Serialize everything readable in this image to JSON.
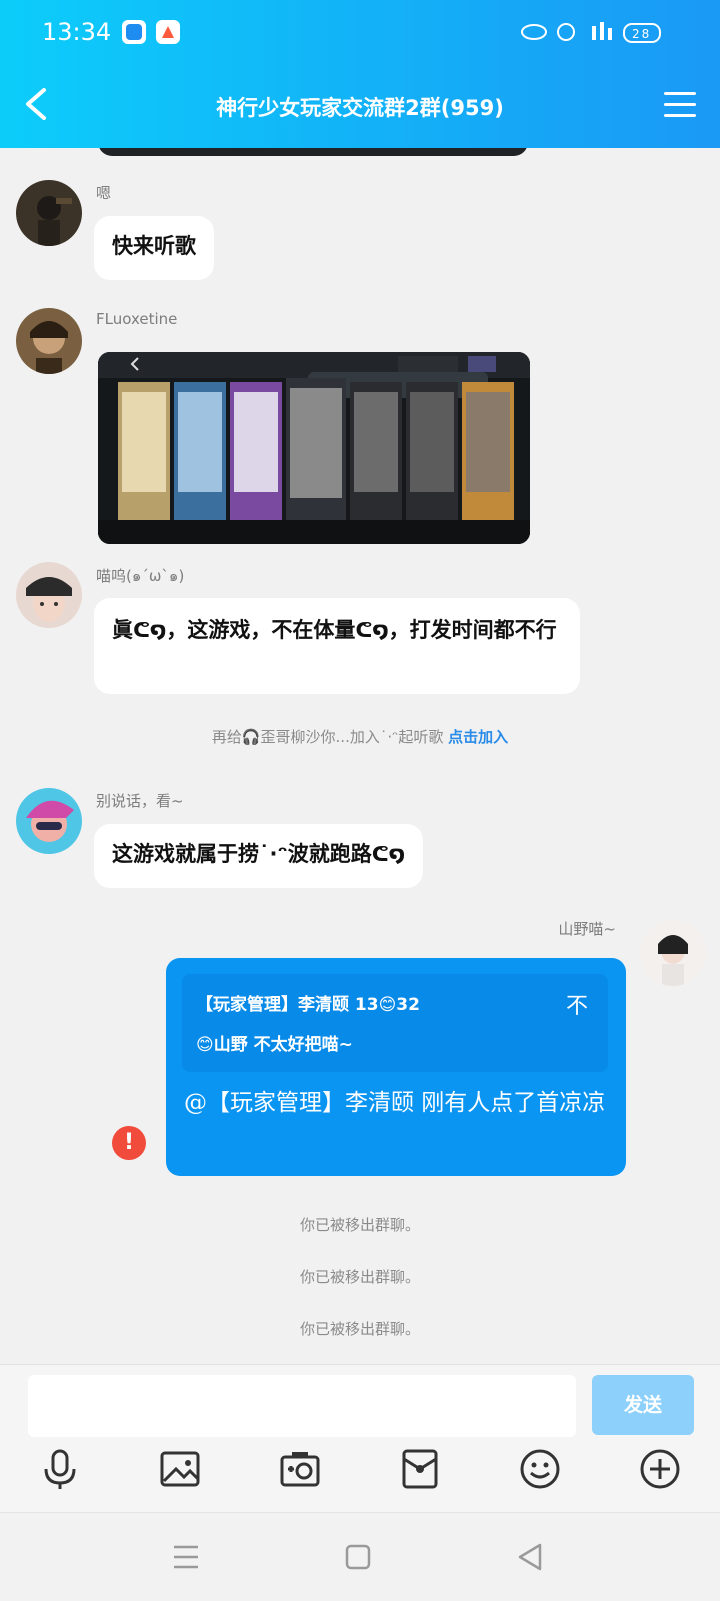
{
  "status_bar": {
    "time": "13:34",
    "right_indicators": "HD 4G 28",
    "battery": "28"
  },
  "header": {
    "title": "神行少女玩家交流群2群(959)"
  },
  "messages": [
    {
      "sender": "嗯",
      "text": "快来听歌"
    },
    {
      "sender": "FLuoxetine",
      "type": "image"
    },
    {
      "sender": "喵呜(๑´ω`๑)",
      "text": "眞ᕦ໑，这游戏，不在体量ᕦ໑，打发时间都不行"
    },
    {
      "sender": "别说话，看~",
      "text": "这游戏就属于捞˙·ᵔ波就跑路ᕦ໑"
    }
  ],
  "system_invite": {
    "text": "再给🎧歪哥柳沙你...加入˙·ᵔ起听歌",
    "link": "点击加入"
  },
  "my_message": {
    "sender": "山野喵~",
    "quote_line1": "【玩家管理】李清颐 13😊32",
    "quote_line2": "😊山野 不太好把喵~",
    "quote_close": "不",
    "text": "@【玩家管理】李清颐 刚有人点了首凉凉"
  },
  "system_notices": [
    "你已被移出群聊。",
    "你已被移出群聊。",
    "你已被移出群聊。"
  ],
  "input": {
    "placeholder": "",
    "send_label": "发送"
  },
  "toolbar": [
    "mic-icon",
    "image-icon",
    "camera-icon",
    "red-packet-icon",
    "emoji-icon",
    "plus-icon"
  ],
  "nav": [
    "menu-icon",
    "home-icon",
    "back-icon"
  ],
  "colors": {
    "header_start": "#0ccdfa",
    "header_end": "#1a99f5",
    "my_bubble": "#0b95f3",
    "send_button": "#8cd0fb",
    "error": "#f14b3b",
    "link": "#2a8be8"
  }
}
